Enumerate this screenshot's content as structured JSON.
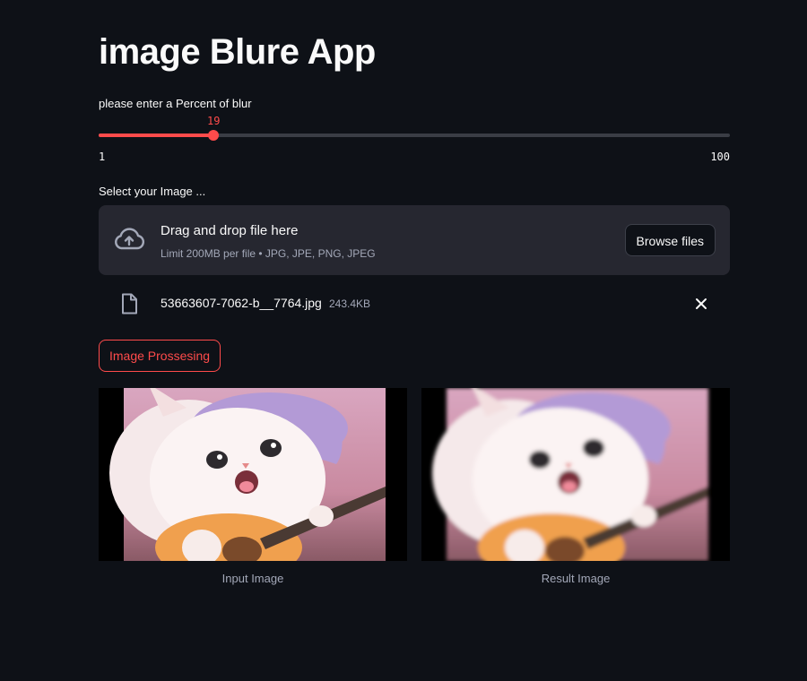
{
  "app": {
    "title": "image Blure App"
  },
  "slider": {
    "label": "please enter a Percent of blur",
    "value": 19,
    "min": 1,
    "max": 100,
    "accent": "#ff4b4b"
  },
  "uploader": {
    "label": "Select your Image ...",
    "drop_title": "Drag and drop file here",
    "drop_subtitle": "Limit 200MB per file • JPG, JPE, PNG, JPEG",
    "browse_label": "Browse files",
    "icon": "cloud-upload-icon"
  },
  "file": {
    "name": "53663607-7062-b__7764.jpg",
    "size": "243.4KB",
    "icon": "file-icon",
    "close_icon": "close-icon"
  },
  "actions": {
    "process_label": "Image Prossesing"
  },
  "images": {
    "input_caption": "Input Image",
    "result_caption": "Result Image"
  }
}
